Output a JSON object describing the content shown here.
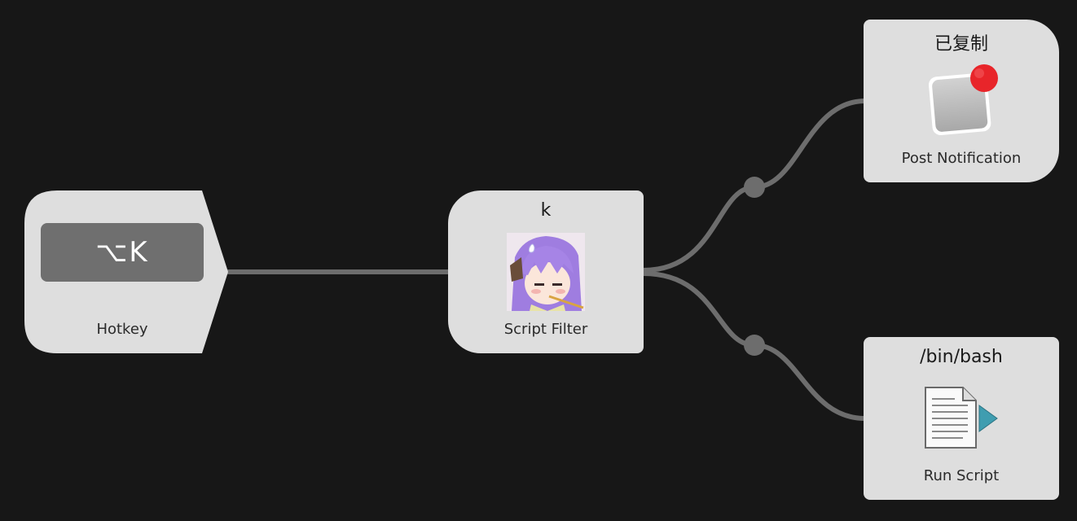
{
  "nodes": {
    "hotkey": {
      "key": "⌥K",
      "label": "Hotkey"
    },
    "script_filter": {
      "title": "k",
      "label": "Script Filter",
      "icon": "anime-girl-avatar-icon"
    },
    "post_notification": {
      "title": "已复制",
      "label": "Post Notification",
      "icon": "notification-badge-icon"
    },
    "run_script": {
      "title": "/bin/bash",
      "label": "Run Script",
      "icon": "script-document-icon"
    }
  },
  "colors": {
    "background": "#171717",
    "node": "#dedede",
    "connector": "#6d6d6d",
    "hotkey_key": "#6f6f6f",
    "badge": "#e8252a",
    "run_arrow": "#3f9db0"
  }
}
